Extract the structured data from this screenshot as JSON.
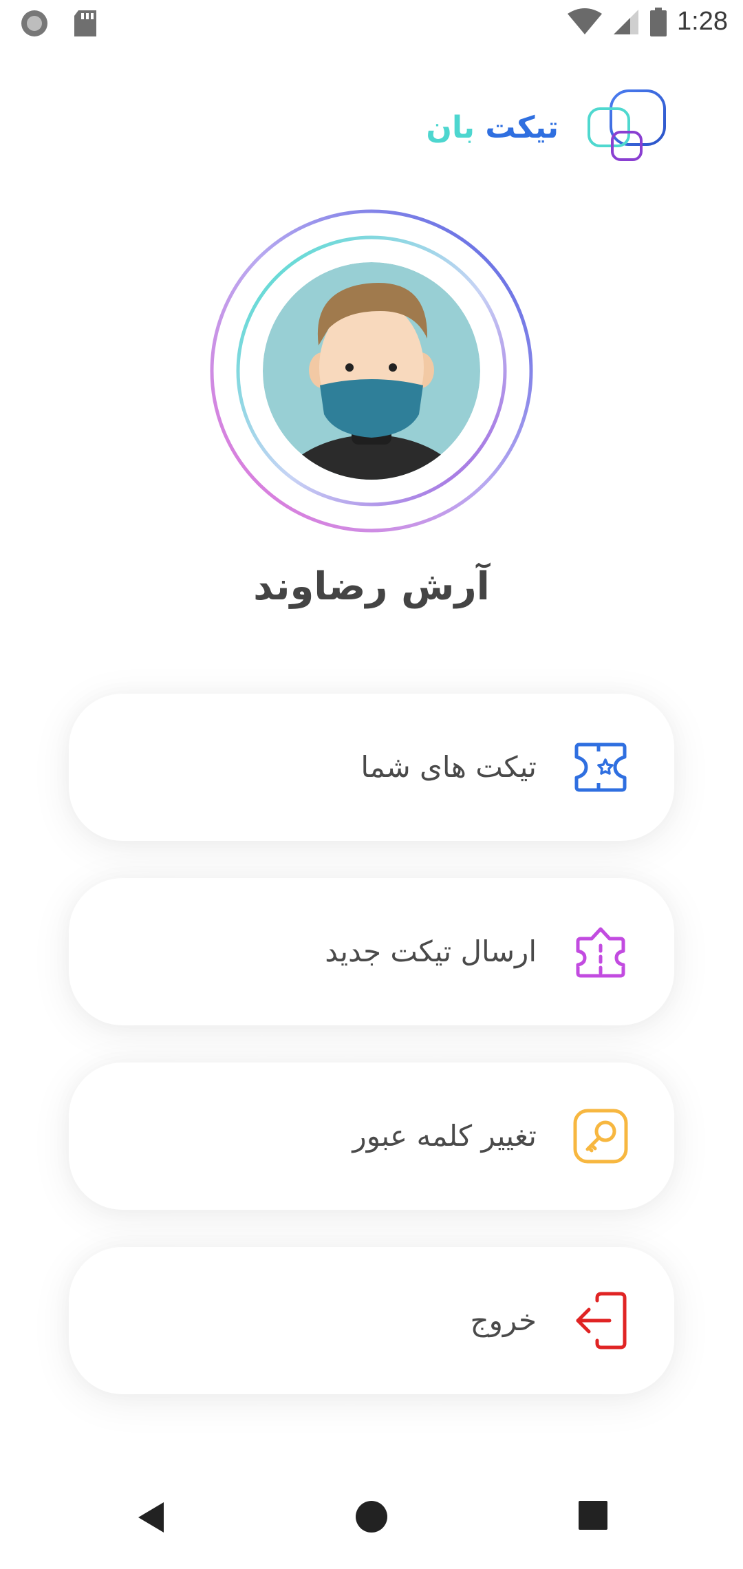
{
  "status_bar": {
    "time": "1:28",
    "icons": [
      "record-indicator-icon",
      "sd-card-icon",
      "wifi-icon",
      "signal-icon",
      "battery-icon"
    ]
  },
  "brand": {
    "name_part1": "تیکت",
    "name_part2": "بان",
    "colors": {
      "blue": "#2f6fe0",
      "teal": "#4dd6cf",
      "purple": "#8a3fd1"
    }
  },
  "profile": {
    "name": "آرش رضاوند",
    "ring_colors": [
      "#e06fd6",
      "#7a7fe6",
      "#48dccc"
    ]
  },
  "menu": [
    {
      "label": "تیکت های شما",
      "icon": "ticket-star-icon",
      "color": "#2f6fe0"
    },
    {
      "label": "ارسال تیکت جدید",
      "icon": "ticket-send-icon",
      "color": "#c24be0"
    },
    {
      "label": "تغییر کلمه عبور",
      "icon": "key-icon",
      "color": "#f7b740"
    },
    {
      "label": "خروج",
      "icon": "logout-icon",
      "color": "#e02424"
    }
  ],
  "nav_bar": {
    "buttons": [
      "back-icon",
      "home-icon",
      "recents-icon"
    ]
  }
}
